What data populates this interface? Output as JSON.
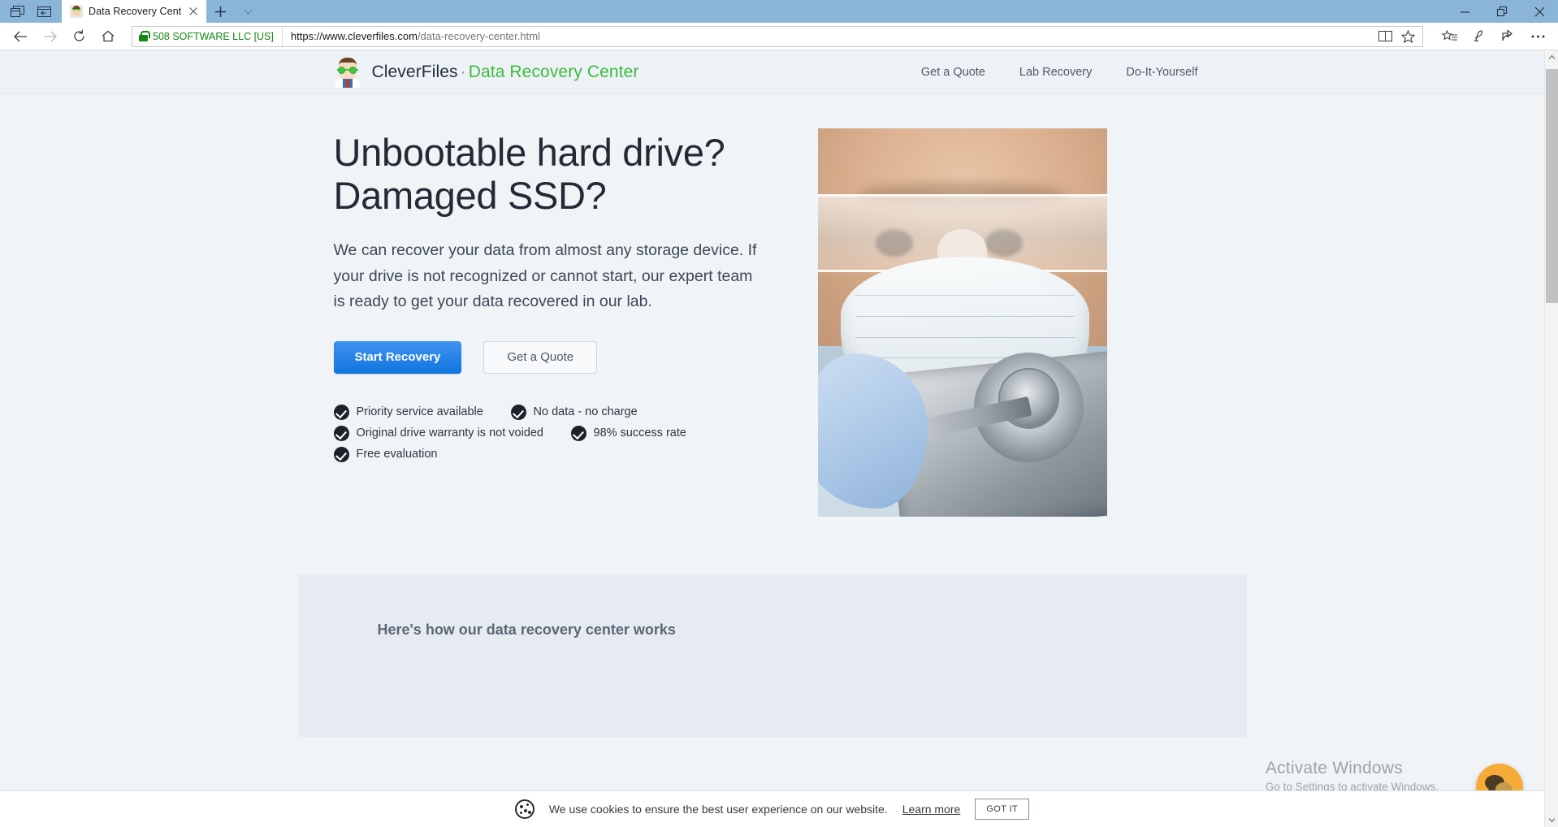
{
  "browser": {
    "tab": {
      "title": "Data Recovery Center b",
      "favicon_name": "cleverfiles-avatar-favicon"
    },
    "tabstrip_icons": [
      "tab-preview-icon",
      "set-aside-tabs-icon",
      "new-tab-icon",
      "tab-list-chevron-icon"
    ],
    "window_controls": [
      "minimize",
      "restore",
      "close"
    ],
    "nav": {
      "back": "back-arrow",
      "forward": "forward-arrow",
      "refresh": "refresh-arrow",
      "home": "home-icon"
    },
    "address": {
      "security_label": "508 SOFTWARE LLC [US]",
      "url_scheme": "https://www.cleverfiles.com",
      "url_path": "/data-recovery-center.html",
      "url_full": "https://www.cleverfiles.com/data-recovery-center.html"
    },
    "address_icons": [
      "reading-view-icon",
      "add-favorite-star-icon"
    ],
    "toolbar_icons": [
      "favorites-hub-icon",
      "web-note-icon",
      "share-icon",
      "settings-more-icon"
    ]
  },
  "site": {
    "brand": {
      "name": "CleverFiles",
      "separator": "·",
      "subtitle": "Data Recovery Center",
      "brand_color": "#3dbb3d"
    },
    "nav_links": [
      {
        "label": "Get a Quote"
      },
      {
        "label": "Lab Recovery"
      },
      {
        "label": "Do-It-Yourself"
      }
    ]
  },
  "hero": {
    "headline": "Unbootable hard drive? Damaged SSD?",
    "paragraph": "We can recover your data from almost any storage device. If your drive is not recognized or cannot start, our expert team is ready to get your data recovered in our lab.",
    "primary_button": "Start Recovery",
    "secondary_button": "Get a Quote",
    "primary_button_color": "#1174e0",
    "features": [
      {
        "label": "Priority service available"
      },
      {
        "label": "No data - no charge"
      },
      {
        "label": "Original drive warranty is not voided"
      },
      {
        "label": "98% success rate"
      },
      {
        "label": "Free evaluation"
      }
    ],
    "image_alt": "lab-technician-examining-open-hard-drive"
  },
  "lower_section": {
    "title": "Here's how our data recovery center works"
  },
  "watermark": {
    "line1": "Activate Windows",
    "line2": "Go to Settings to activate Windows."
  },
  "chat": {
    "icon_name": "chat-bubbles-icon",
    "color": "#f5ab38"
  },
  "cookie_bar": {
    "message": "We use cookies to ensure the best user experience on our website.",
    "link": "Learn more",
    "button": "GOT IT"
  }
}
